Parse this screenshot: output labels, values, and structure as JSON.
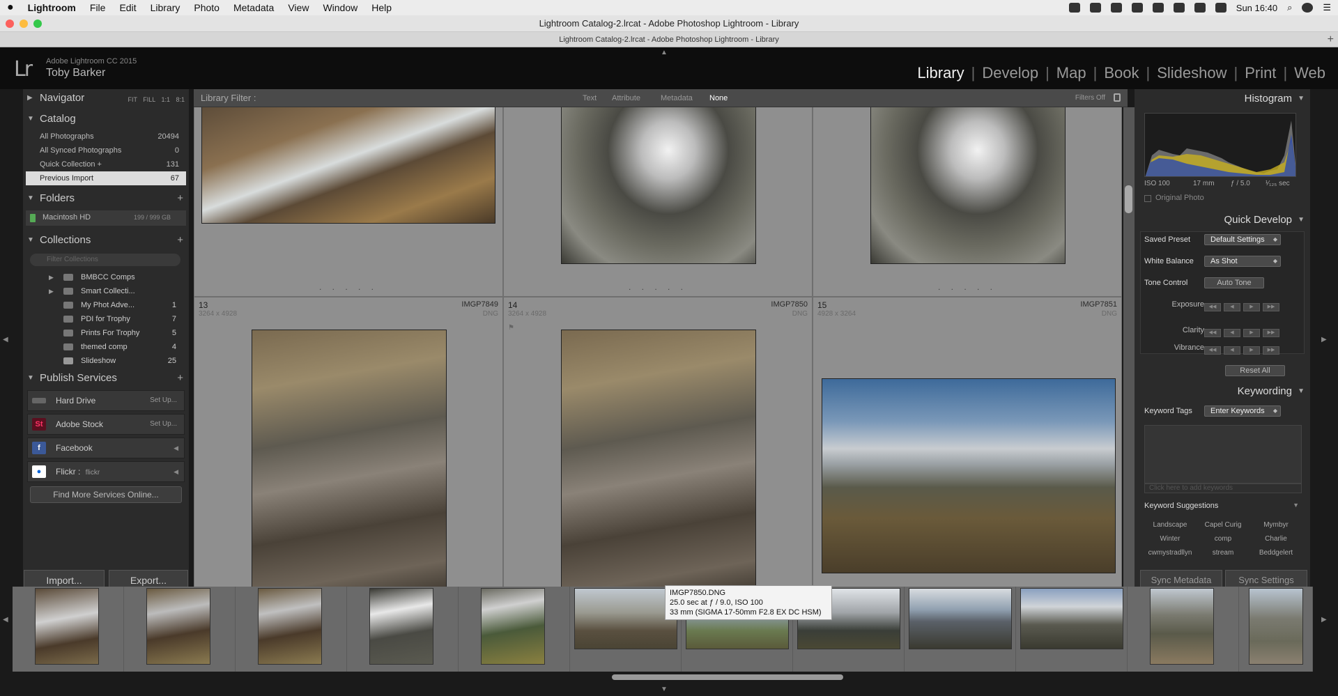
{
  "menubar": {
    "apple": "",
    "app": "Lightroom",
    "items": [
      "File",
      "Edit",
      "Library",
      "Photo",
      "Metadata",
      "View",
      "Window",
      "Help"
    ],
    "clock": "Sun 16:40"
  },
  "window": {
    "title": "Lightroom Catalog-2.lrcat - Adobe Photoshop Lightroom - Library",
    "tab_title": "Lightroom Catalog-2.lrcat - Adobe Photoshop Lightroom - Library"
  },
  "identity": {
    "logo": "Lr",
    "product": "Adobe Lightroom CC 2015",
    "user": "Toby Barker"
  },
  "modules": [
    "Library",
    "Develop",
    "Map",
    "Book",
    "Slideshow",
    "Print",
    "Web"
  ],
  "active_module": "Library",
  "left": {
    "navigator": {
      "title": "Navigator",
      "options": "FIT FILL 1:1 8:1"
    },
    "catalog": {
      "title": "Catalog",
      "items": [
        {
          "label": "All Photographs",
          "count": "20494"
        },
        {
          "label": "All Synced Photographs",
          "count": "0"
        },
        {
          "label": "Quick Collection +",
          "count": "131"
        },
        {
          "label": "Previous Import",
          "count": "67"
        }
      ]
    },
    "folders": {
      "title": "Folders",
      "drive": "Macintosh HD",
      "drive_space": "199 / 999 GB"
    },
    "collections": {
      "title": "Collections",
      "search_placeholder": "Filter Collections",
      "items": [
        {
          "label": "BMBCC Comps",
          "count": ""
        },
        {
          "label": "Smart Collecti...",
          "count": ""
        },
        {
          "label": "My Phot Adve...",
          "count": "1"
        },
        {
          "label": "PDI for Trophy",
          "count": "7"
        },
        {
          "label": "Prints For Trophy",
          "count": "5"
        },
        {
          "label": "themed comp",
          "count": "4"
        },
        {
          "label": "Slideshow",
          "count": "25"
        }
      ]
    },
    "publish": {
      "title": "Publish Services",
      "services": [
        {
          "label": "Hard Drive",
          "sub": "Set Up..."
        },
        {
          "label": "Adobe Stock",
          "sub": "Set Up..."
        },
        {
          "label": "Facebook",
          "sub": ""
        },
        {
          "label": "Flickr :",
          "sub": "flickr"
        }
      ],
      "find_more": "Find More Services Online..."
    },
    "import_label": "Import...",
    "export_label": "Export..."
  },
  "filterbar": {
    "label": "Library Filter :",
    "tabs": [
      "Text",
      "Attribute",
      "Metadata",
      "None"
    ],
    "filters_off": "Filters Off"
  },
  "grid": {
    "cells": [
      {
        "num": "13",
        "name": "IMGP7849",
        "dims": "3264 x 4928",
        "ext": "DNG"
      },
      {
        "num": "14",
        "name": "IMGP7850",
        "dims": "3264 x 4928",
        "ext": "DNG"
      },
      {
        "num": "15",
        "name": "IMGP7851",
        "dims": "4928 x 3264",
        "ext": "DNG"
      }
    ],
    "dots": ". . . . ."
  },
  "right": {
    "histogram": {
      "title": "Histogram",
      "iso": "ISO 100",
      "focal": "17 mm",
      "aperture": "ƒ / 5.0",
      "shutter": "¹⁄₁₂₅ sec",
      "original": "Original Photo"
    },
    "quick_develop": {
      "title": "Quick Develop",
      "saved_preset_label": "Saved Preset",
      "saved_preset_value": "Default Settings",
      "wb_label": "White Balance",
      "wb_value": "As Shot",
      "tone_label": "Tone Control",
      "auto_tone": "Auto Tone",
      "exposure": "Exposure",
      "clarity": "Clarity",
      "vibrance": "Vibrance",
      "reset": "Reset All"
    },
    "keywording": {
      "title": "Keywording",
      "tags_label": "Keyword Tags",
      "tags_value": "Enter Keywords",
      "hint": "Click here to add keywords",
      "suggestions_title": "Keyword Suggestions",
      "suggestions": [
        "Landscape",
        "Capel Curig",
        "Mymbyr",
        "Winter",
        "comp",
        "Charlie",
        "cwmystradllyn",
        "stream",
        "Beddgelert"
      ]
    },
    "sync_metadata": "Sync Metadata",
    "sync_settings": "Sync Settings"
  },
  "tooltip": {
    "line1": "IMGP7850.DNG",
    "line2": "25.0 sec at ƒ / 9.0, ISO 100",
    "line3": "33 mm (SIGMA 17-50mm F2.8 EX DC HSM)"
  },
  "colors": {
    "accent": "#eeeeee",
    "panel": "#2b2b2b",
    "grid": "#858585"
  }
}
